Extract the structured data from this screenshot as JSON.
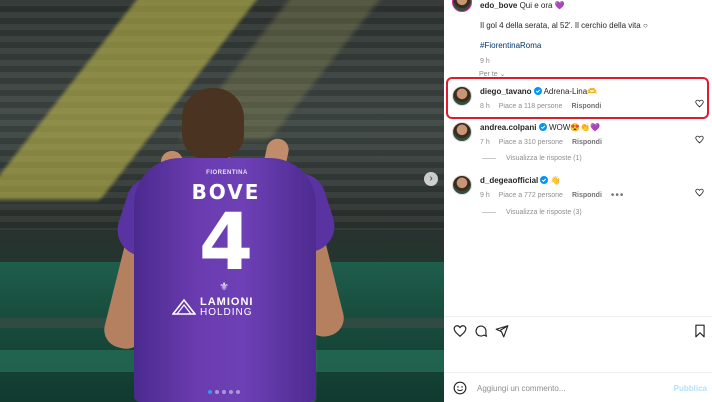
{
  "post": {
    "author": "edo_bove",
    "caption_head": "Qui e ora",
    "caption_line": "Il gol 4 della serata, al 52'. Il cerchio della vita ○",
    "hashtag": "#FiorentinaRoma",
    "time": "9 h",
    "see_translation": "Per te"
  },
  "media": {
    "jersey_collar": "FIORENTINA",
    "jersey_name": "BOVE",
    "jersey_number": "4",
    "sponsor_line1": "LAMIONI",
    "sponsor_line2": "HOLDING",
    "carousel_dots": 5,
    "carousel_active_index": 0
  },
  "comments": [
    {
      "user": "diego_tavano",
      "verified": true,
      "text": "Adrena-Lina🫶",
      "time": "8 h",
      "likes": "Piace a 118 persone",
      "reply": "Rispondi",
      "highlighted": true
    },
    {
      "user": "andrea.colpani",
      "verified": true,
      "text": "WOW😍👏💜",
      "time": "7 h",
      "likes": "Piace a 310 persone",
      "reply": "Rispondi",
      "view_replies": "Visualizza le risposte (1)"
    },
    {
      "user": "d_degeaofficial",
      "verified": true,
      "text": "👋",
      "time": "9 h",
      "likes": "Piace a 772 persone",
      "reply": "Rispondi",
      "more": "•••",
      "view_replies": "Visualizza le risposte (3)"
    }
  ],
  "composer": {
    "placeholder": "Aggiungi un commento...",
    "publish": "Pubblica"
  },
  "colors": {
    "highlight_border": "#e01b2e",
    "link": "#00376b",
    "verified": "#0095f6",
    "publish_disabled": "#b2dffc"
  },
  "icons": [
    "heart-icon",
    "comment-icon",
    "share-icon",
    "bookmark-icon",
    "emoji-icon",
    "verified-icon",
    "chevron-right-icon",
    "chevron-down-icon"
  ]
}
